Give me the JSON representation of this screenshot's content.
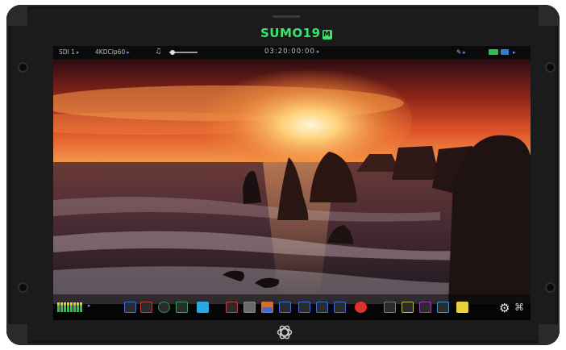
{
  "device": {
    "brand": "SUMO19",
    "brand_badge": "M"
  },
  "status_bar": {
    "input": "SDI 1",
    "resolution": "4KDCIp60",
    "timecode": "03:20:00:00",
    "headphone_icon": "headphone-icon",
    "volume_level": 0.1,
    "record_icon": "pencil-icon",
    "arrow": "▸"
  },
  "bottom_toolbar": {
    "settings_icon": "gear-icon",
    "logo_icon": "atomos-logo-icon",
    "tools": [
      {
        "name": "waveform-tool",
        "color": "#3a6ed8"
      },
      {
        "name": "vectorscope-tool",
        "color": "#c04040"
      },
      {
        "name": "focus-peaking-tool",
        "color": "#2f8f4a"
      },
      {
        "name": "zebra-tool",
        "color": "#3aa055"
      },
      {
        "name": "false-color-tool",
        "color": "#2aa6e0"
      },
      {
        "name": "red-channel-tool",
        "color": "#c04040"
      },
      {
        "name": "frame-guides-tool",
        "color": "#8a8a8a"
      },
      {
        "name": "histogram-tool",
        "color": "#d07030"
      },
      {
        "name": "lut-tool",
        "color": "#3a6ed8"
      },
      {
        "name": "rgb-parade-tool",
        "color": "#3a6ed8"
      },
      {
        "name": "aspect-tool",
        "color": "#3a6ed8"
      },
      {
        "name": "anamorphic-tool",
        "color": "#3a6ed8"
      },
      {
        "name": "record-mode-tool",
        "color": "#e03030"
      },
      {
        "name": "playback-tool",
        "color": "#7a7a7a"
      },
      {
        "name": "scope-a-tool",
        "color": "#c0c040"
      },
      {
        "name": "scope-b-tool",
        "color": "#a040c0"
      },
      {
        "name": "scope-c-tool",
        "color": "#4090d0"
      },
      {
        "name": "yellow-tool",
        "color": "#e6d23a"
      }
    ]
  }
}
